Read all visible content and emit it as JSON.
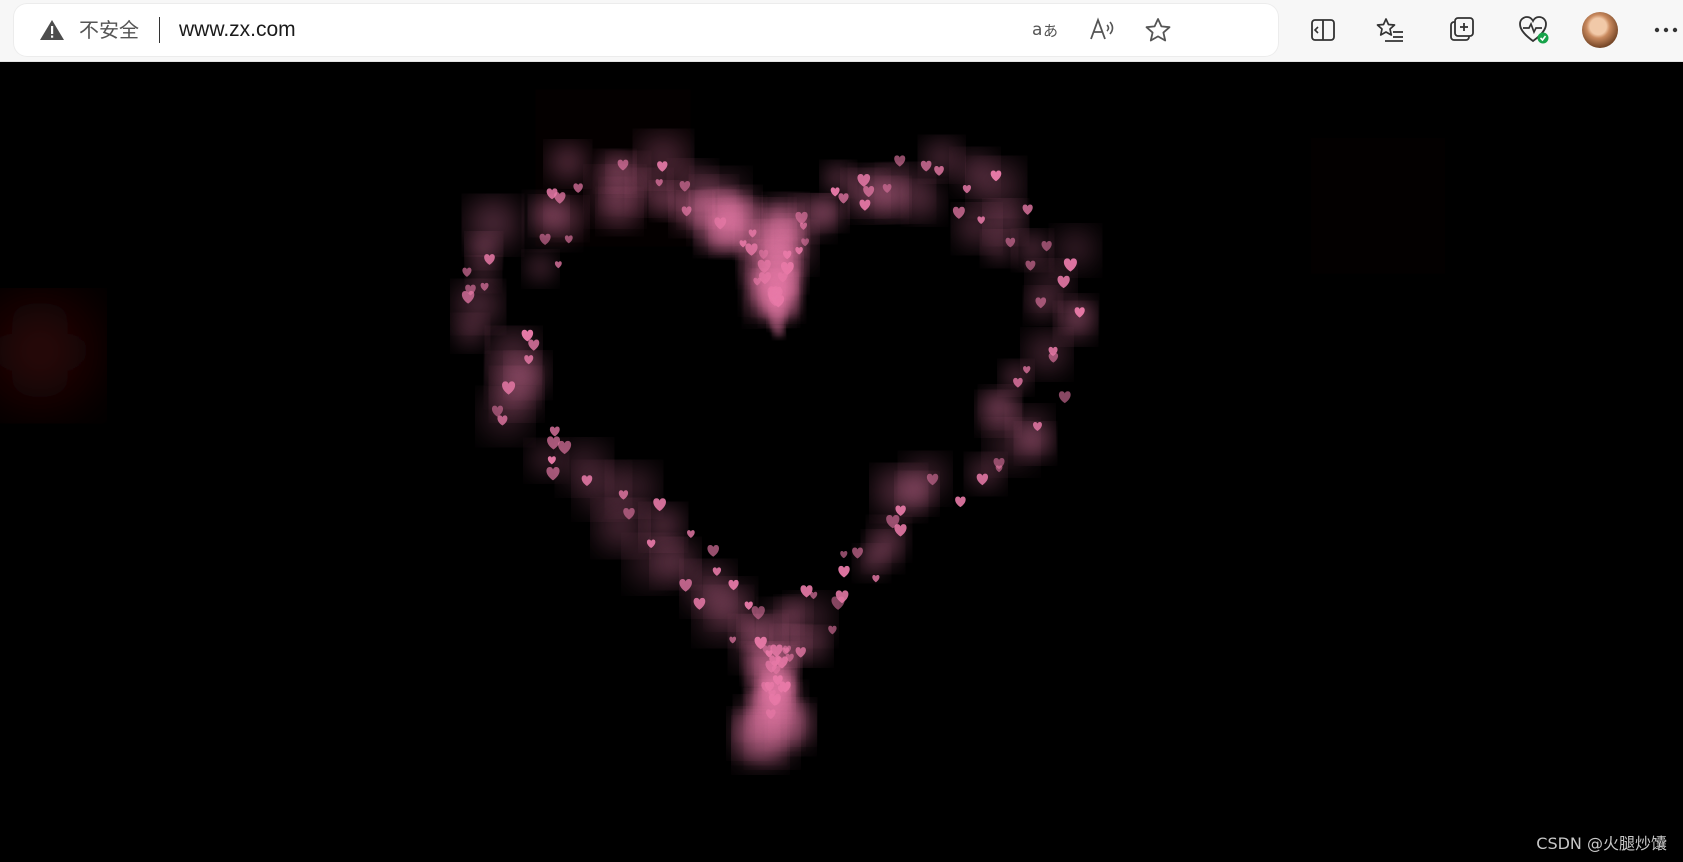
{
  "browser": {
    "security_label": "不安全",
    "url": "www.zx.com",
    "icons": {
      "security": "warning-triangle-icon",
      "read_translate": "translate-icon",
      "read_aloud": "read-aloud-icon",
      "favorite": "star-icon",
      "split_screen": "split-screen-icon",
      "favorites_list": "favorites-list-icon",
      "collections": "collections-icon",
      "browser_essentials": "heart-pulse-icon",
      "profile": "avatar",
      "more": "more-icon"
    }
  },
  "page": {
    "background": "#000000",
    "heart_color_main": "#e87aa8",
    "heart_color_bg": "#8b1a1f",
    "watermark": "CSDN @火腿炒馕"
  }
}
